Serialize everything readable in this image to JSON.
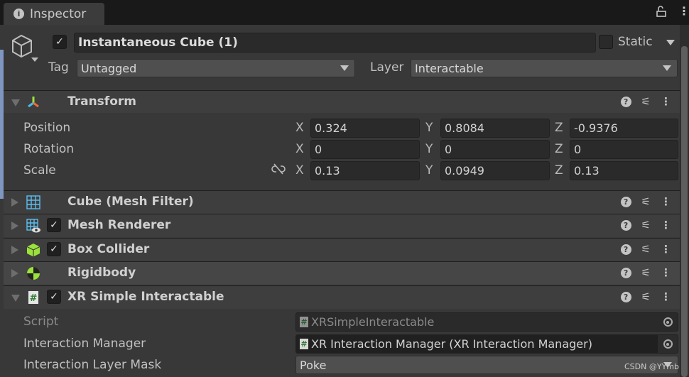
{
  "tab": {
    "title": "Inspector",
    "icon": "info-icon"
  },
  "header": {
    "active": true,
    "name": "Instantaneous Cube (1)",
    "static_label": "Static",
    "static": false,
    "tag_label": "Tag",
    "tag": "Untagged",
    "layer_label": "Layer",
    "layer": "Interactable"
  },
  "transform": {
    "title": "Transform",
    "rows": [
      {
        "label": "Position",
        "x": "0.324",
        "y": "0.8084",
        "z": "-0.9376"
      },
      {
        "label": "Rotation",
        "x": "0",
        "y": "0",
        "z": "0"
      },
      {
        "label": "Scale",
        "x": "0.13",
        "y": "0.0949",
        "z": "0.13"
      }
    ],
    "axes": [
      "X",
      "Y",
      "Z"
    ]
  },
  "components": [
    {
      "title": "Cube (Mesh Filter)",
      "icon": "mesh-filter-icon",
      "checkbox": false
    },
    {
      "title": "Mesh Renderer",
      "icon": "mesh-renderer-icon",
      "checkbox": true
    },
    {
      "title": "Box Collider",
      "icon": "box-collider-icon",
      "checkbox": true
    },
    {
      "title": "Rigidbody",
      "icon": "rigidbody-icon",
      "checkbox": false
    },
    {
      "title": "XR Simple Interactable",
      "icon": "script-icon",
      "checkbox": true
    }
  ],
  "xr": {
    "script_label": "Script",
    "script": "XRSimpleInteractable",
    "manager_label": "Interaction Manager",
    "manager": "XR Interaction Manager (XR Interaction Manager)",
    "mask_label": "Interaction Layer Mask",
    "mask": "Poke"
  },
  "watermark": "CSDN @YYmb"
}
